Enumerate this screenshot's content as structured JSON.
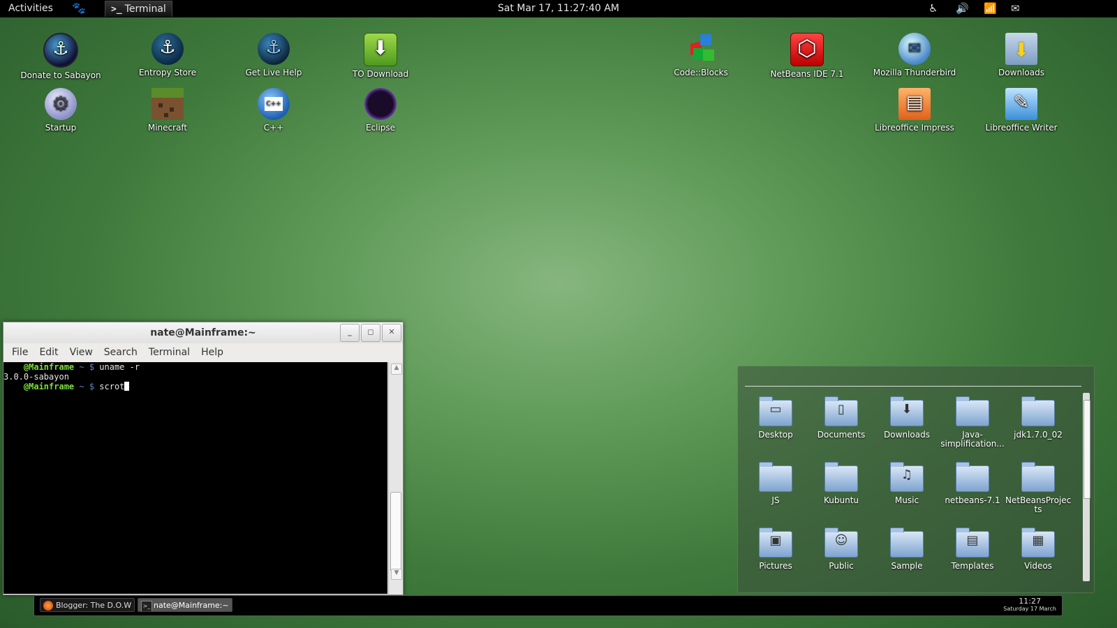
{
  "top_panel": {
    "activities": "Activities",
    "app_glyph": ">_",
    "app_name": "Terminal",
    "datetime": "Sat Mar 17, 11:27:40 AM",
    "status_icons": [
      "accessibility-icon",
      "volume-icon",
      "wifi-icon",
      "user-icon"
    ]
  },
  "desktop_icons": [
    {
      "label": "Donate to Sabayon",
      "icon": "sabayon-logo-icon"
    },
    {
      "label": "Entropy Store",
      "icon": "entropy-store-icon"
    },
    {
      "label": "Get Live Help",
      "icon": "live-help-icon"
    },
    {
      "label": "TO Download",
      "icon": "download-icon"
    },
    {
      "label": "Code::Blocks",
      "icon": "codeblocks-icon"
    },
    {
      "label": "NetBeans IDE 7.1",
      "icon": "netbeans-icon"
    },
    {
      "label": "Mozilla Thunderbird",
      "icon": "thunderbird-icon"
    },
    {
      "label": "Downloads",
      "icon": "downloads-folder-icon"
    },
    {
      "label": "Startup",
      "icon": "startup-icon"
    },
    {
      "label": "Minecraft",
      "icon": "minecraft-icon"
    },
    {
      "label": "C++",
      "icon": "cpp-icon"
    },
    {
      "label": "Eclipse",
      "icon": "eclipse-icon"
    },
    {
      "label": "Libreoffice Impress",
      "icon": "impress-icon"
    },
    {
      "label": "Libreoffice Writer",
      "icon": "writer-icon"
    }
  ],
  "terminal": {
    "title": "nate@Mainframe:~",
    "menu": [
      "File",
      "Edit",
      "View",
      "Search",
      "Terminal",
      "Help"
    ],
    "lines": [
      {
        "host": "@Mainframe",
        "sep": " ~ $ ",
        "cmd": "uname -r"
      },
      {
        "output": "3.0.0-sabayon"
      },
      {
        "host": "@Mainframe",
        "sep": " ~ $ ",
        "cmd": "scrot"
      }
    ]
  },
  "files_panel": {
    "folders": [
      {
        "label": "Desktop",
        "glyph": "▭"
      },
      {
        "label": "Documents",
        "glyph": "▯"
      },
      {
        "label": "Downloads",
        "glyph": "⬇"
      },
      {
        "label": "Java-\nsimplification...",
        "glyph": ""
      },
      {
        "label": "jdk1.7.0_02",
        "glyph": ""
      },
      {
        "label": "JS",
        "glyph": ""
      },
      {
        "label": "Kubuntu",
        "glyph": ""
      },
      {
        "label": "Music",
        "glyph": "♫"
      },
      {
        "label": "netbeans-7.1",
        "glyph": ""
      },
      {
        "label": "NetBeansProjec\nts",
        "glyph": ""
      },
      {
        "label": "Pictures",
        "glyph": "▣"
      },
      {
        "label": "Public",
        "glyph": "☺"
      },
      {
        "label": "Sample",
        "glyph": ""
      },
      {
        "label": "Templates",
        "glyph": "▤"
      },
      {
        "label": "Videos",
        "glyph": "▦"
      }
    ]
  },
  "bottom_panel": {
    "tasks": [
      {
        "label": "Blogger: The D.O.W - ...",
        "icon": "firefox-icon",
        "active": false
      },
      {
        "label": "nate@Mainframe:~",
        "icon": "terminal-icon",
        "active": true
      }
    ],
    "clock_time": "11:27",
    "clock_date": "Saturday 17 March"
  }
}
